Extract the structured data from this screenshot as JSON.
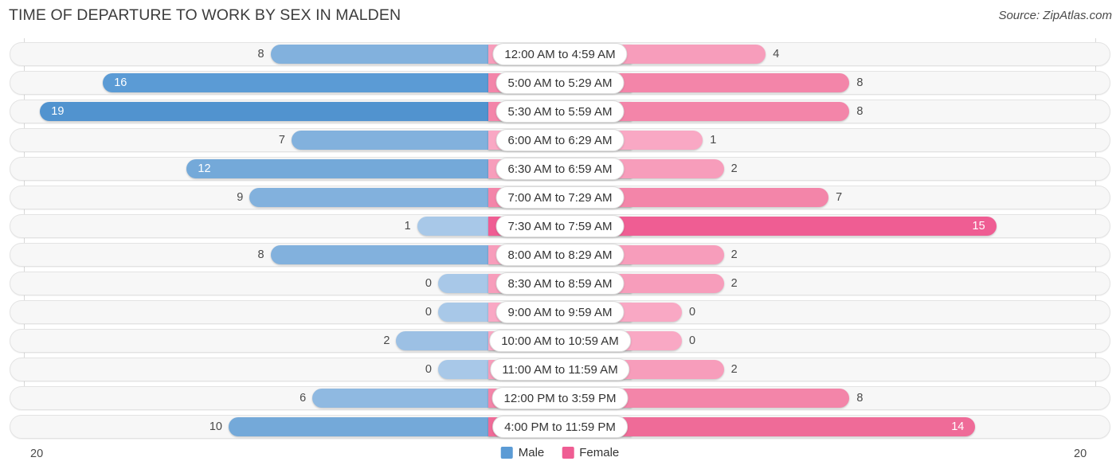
{
  "header": {
    "title": "TIME OF DEPARTURE TO WORK BY SEX IN MALDEN",
    "source": "Source: ZipAtlas.com"
  },
  "axis": {
    "left_label": "20",
    "right_label": "20"
  },
  "legend": {
    "items": [
      {
        "label": "Male",
        "color": "#5b9bd5"
      },
      {
        "label": "Female",
        "color": "#ef5d93"
      }
    ]
  },
  "chart_data": {
    "type": "bar",
    "title": "TIME OF DEPARTURE TO WORK BY SEX IN MALDEN",
    "subtitle": "Source: ZipAtlas.com",
    "orientation": "horizontal-diverging",
    "xlabel": "",
    "ylabel": "",
    "xlim": [
      20,
      20
    ],
    "grid": true,
    "legend_position": "bottom-center",
    "categories": [
      "12:00 AM to 4:59 AM",
      "5:00 AM to 5:29 AM",
      "5:30 AM to 5:59 AM",
      "6:00 AM to 6:29 AM",
      "6:30 AM to 6:59 AM",
      "7:00 AM to 7:29 AM",
      "7:30 AM to 7:59 AM",
      "8:00 AM to 8:29 AM",
      "8:30 AM to 8:59 AM",
      "9:00 AM to 9:59 AM",
      "10:00 AM to 10:59 AM",
      "11:00 AM to 11:59 AM",
      "12:00 PM to 3:59 PM",
      "4:00 PM to 11:59 PM"
    ],
    "series": [
      {
        "name": "Male",
        "side": "left",
        "color": "#5b9bd5",
        "values": [
          8,
          16,
          19,
          7,
          12,
          9,
          1,
          8,
          0,
          0,
          2,
          0,
          6,
          10
        ]
      },
      {
        "name": "Female",
        "side": "right",
        "color": "#ef5d93",
        "values": [
          4,
          8,
          8,
          1,
          2,
          7,
          15,
          2,
          2,
          0,
          0,
          2,
          8,
          14
        ]
      }
    ]
  }
}
